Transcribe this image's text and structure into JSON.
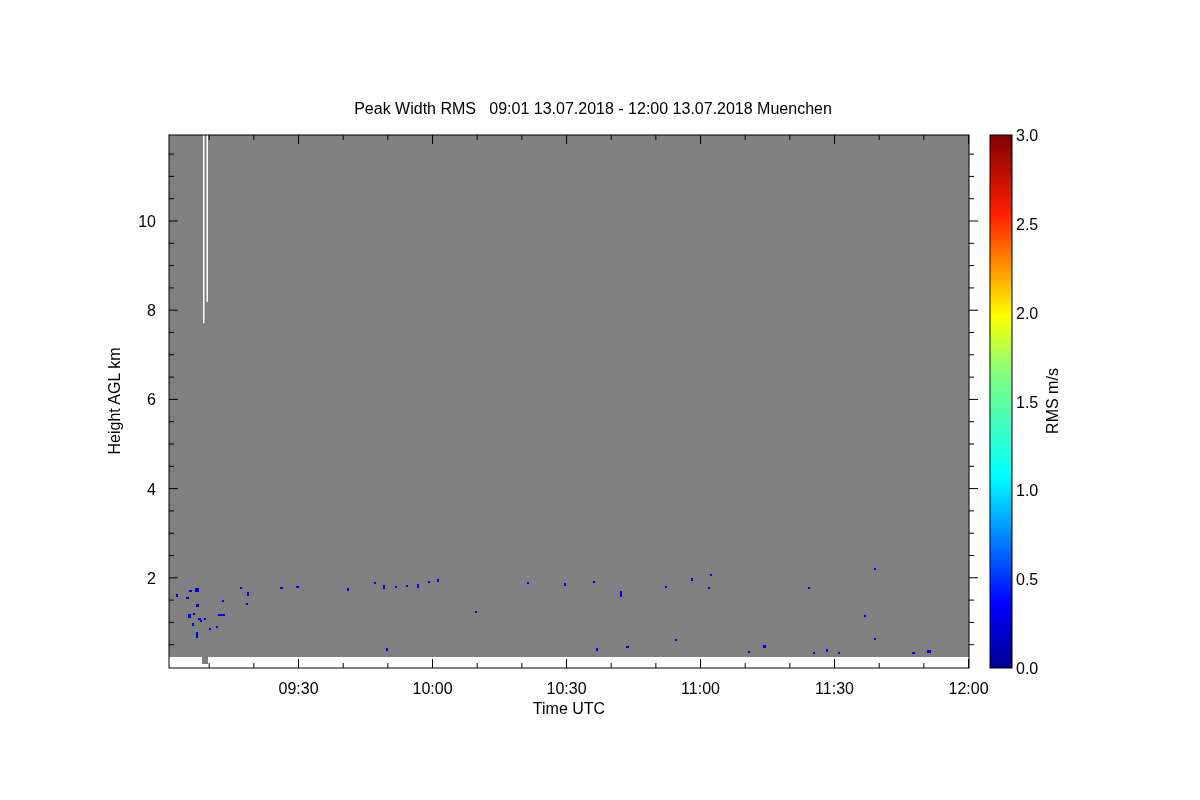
{
  "title": "Peak Width RMS   09:01 13.07.2018 - 12:00 13.07.2018 Muenchen",
  "plot": {
    "xlabel": "Time UTC",
    "ylabel": "Height AGL km",
    "xtick_labels": [
      "09:30",
      "10:00",
      "10:30",
      "11:00",
      "11:30",
      "12:00"
    ],
    "ytick_labels": [
      "10",
      "8",
      "6",
      "4",
      "2"
    ]
  },
  "colorbar": {
    "label": "RMS m/s",
    "tick_labels": [
      "3.0",
      "2.5",
      "2.0",
      "1.5",
      "1.0",
      "0.5",
      "0.0"
    ]
  }
}
